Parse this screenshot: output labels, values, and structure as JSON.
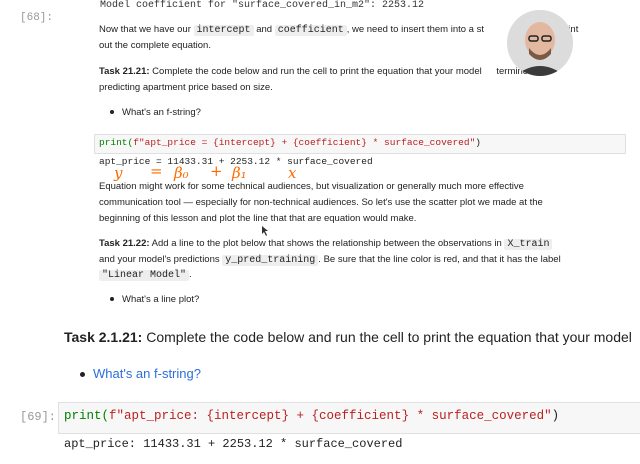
{
  "cells": {
    "prompt_68": "[68]:",
    "prompt_69": "[69]:",
    "top_output": "Model coefficient for \"surface_covered_in_m2\": 2253.12",
    "para1_a": "Now that we have our",
    "code_intercept": "intercept",
    "para1_and": "and",
    "code_coefficient": "coefficient",
    "para1_b": ", we need to insert them into a st",
    "para1_c": "an print",
    "para1_line2": "out the complete equation.",
    "task_a_label": "Task 21.21:",
    "task_a_text1": "Complete the code below and run the cell to print the equation that your model",
    "task_a_text1b": "termined for",
    "task_a_text2": "predicting apartment price based on size.",
    "bullet_fstring_small": "What's an f-string?",
    "code_small": {
      "print": "print(",
      "fstr": "f\"apt_price = {intercept} + {coefficient} * surface_covered\"",
      "close": ")"
    },
    "output_small": "apt_price = 11433.31 + 2253.12 * surface_covered",
    "para2_line1": "Equation might work for some technical audiences, but visualization or generally much more effective",
    "para2_line2": "communication tool — especially for non-technical audiences. So let's use the scatter plot we made at the",
    "para2_line3": "beginning of this lesson and plot the line that that are equation would make.",
    "task_b_label": "Task 21.22:",
    "task_b_text1": "Add a line to the plot below that shows the relationship between the observations in",
    "code_xtrain": "X_train",
    "task_b_text2a": "and your model's predictions",
    "code_ypred": "y_pred_training",
    "task_b_text2b": ". Be sure that the line color is red, and that it has the label",
    "code_linear": "\"Linear Model\"",
    "task_b_dot": ".",
    "bullet_lineplot": "What's a line plot?",
    "task_c_label": "Task 2.1.21:",
    "task_c_text": "Complete the code below and run the cell to print the equation that your model",
    "bullet_fstring_large": "What's an f-string?",
    "code_large": {
      "print": "print(",
      "fstr": "f\"apt_price: {intercept} + {coefficient} * surface_covered\"",
      "close": ")"
    },
    "output_large": "apt_price: 11433.31 + 2253.12 * surface_covered"
  },
  "handwriting": {
    "y": "y",
    "eq": "=",
    "b0": "β₀",
    "plus": "+",
    "b1": "β₁",
    "x": "x"
  },
  "colors": {
    "handwriting": "#ff6a00",
    "link": "#2a6fdb",
    "keyword": "#008000",
    "string": "#ba2121"
  }
}
